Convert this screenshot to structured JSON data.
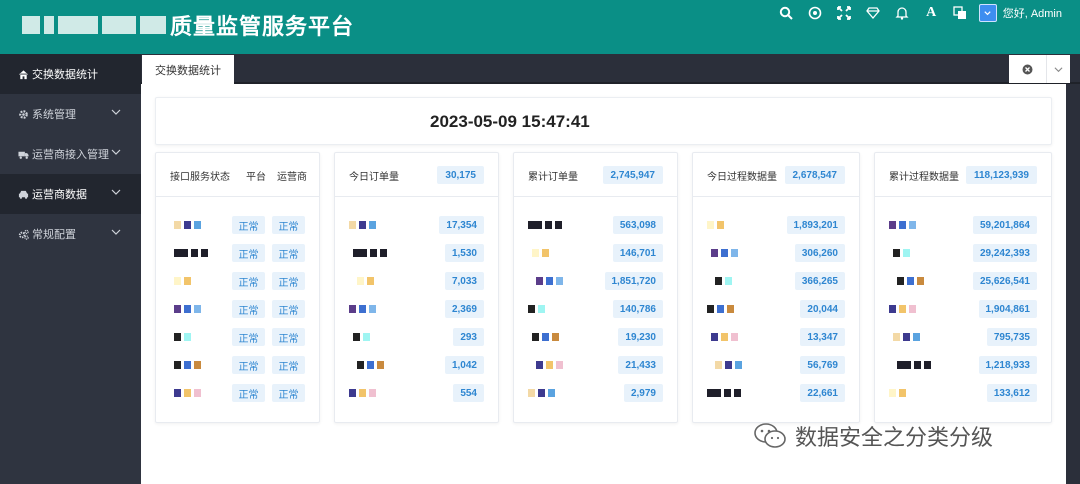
{
  "header": {
    "title": "质量监管服务平台",
    "greeting": "您好, Admin",
    "icons": [
      "search-icon",
      "target-icon",
      "fullscreen-icon",
      "diamond-icon",
      "bell-icon",
      "font-icon",
      "translate-icon",
      "avatar-icon"
    ]
  },
  "sidebar": {
    "items": [
      {
        "label": "交换数据统计",
        "icon": "home-icon"
      },
      {
        "label": "系统管理",
        "icon": "gear-icon"
      },
      {
        "label": "运营商接入管理",
        "icon": "truck-icon"
      },
      {
        "label": "运营商数据",
        "icon": "car-icon"
      },
      {
        "label": "常规配置",
        "icon": "gears-icon"
      }
    ]
  },
  "tabs": {
    "active": "交换数据统计"
  },
  "timestamp": "2023-05-09 15:47:41",
  "status_card": {
    "title": "接口服务状态",
    "col_platform": "平台",
    "col_operator": "运营商",
    "ok_label": "正常",
    "row_count": 7
  },
  "cards": [
    {
      "title": "今日订单量",
      "total": "30,175",
      "values": [
        "17,354",
        "1,530",
        "7,033",
        "2,369",
        "293",
        "1,042",
        "554"
      ]
    },
    {
      "title": "累计订单量",
      "total": "2,745,947",
      "values": [
        "563,098",
        "146,701",
        "1,851,720",
        "140,786",
        "19,230",
        "21,433",
        "2,979"
      ]
    },
    {
      "title": "今日过程数据量",
      "total": "2,678,547",
      "values": [
        "1,893,201",
        "306,260",
        "366,265",
        "20,044",
        "13,347",
        "56,769",
        "22,661"
      ]
    },
    {
      "title": "累计过程数据量",
      "total": "118,123,939",
      "values": [
        "59,201,864",
        "29,242,393",
        "25,626,541",
        "1,904,861",
        "795,735",
        "1,218,933",
        "133,612"
      ]
    }
  ],
  "watermark": "数据安全之分类分级",
  "colors": {
    "header": "#0a8f86",
    "sidebar": "#2f3440",
    "accent_text": "#2e86d1",
    "badge_bg": "#e8f2fb"
  }
}
